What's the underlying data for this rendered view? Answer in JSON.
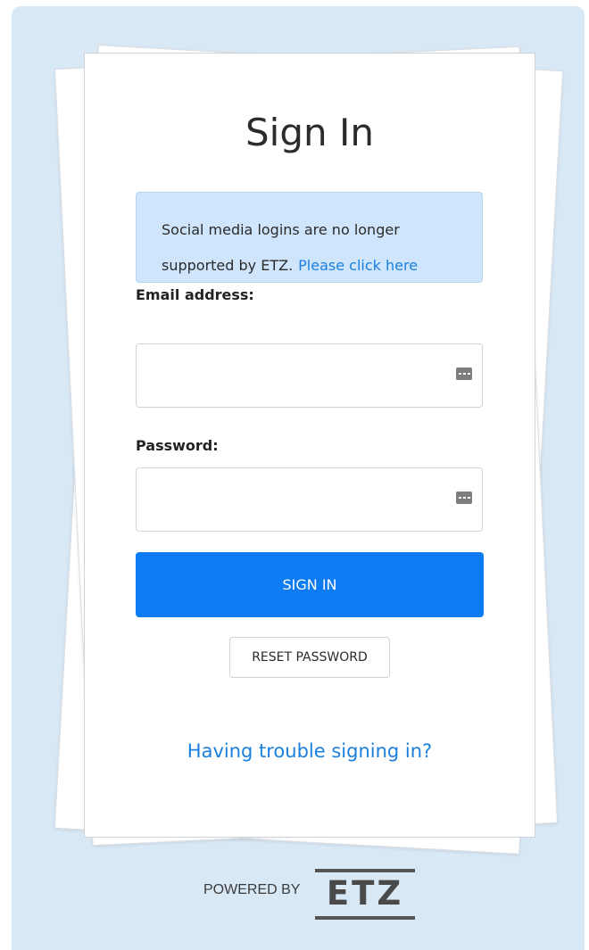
{
  "card": {
    "title": "Sign In",
    "notice": {
      "text_line1": "Social media logins are no longer",
      "text_line2": "supported by ETZ.",
      "link_label": "Please click here"
    },
    "email": {
      "label": "Email address:",
      "value": "",
      "placeholder": ""
    },
    "password": {
      "label": "Password:",
      "value": "",
      "placeholder": ""
    },
    "signin_label": "SIGN IN",
    "reset_label": "RESET PASSWORD",
    "trouble_label": "Having trouble signing in?"
  },
  "footer": {
    "powered_by": "POWERED BY",
    "logo_text": "ETZ"
  },
  "icons": {
    "field_icon": "password-manager-key-icon"
  },
  "colors": {
    "background": "#d8e8f5",
    "primary": "#0d7cf2",
    "link": "#1a7fde",
    "notice_bg": "#cfe5fb"
  }
}
